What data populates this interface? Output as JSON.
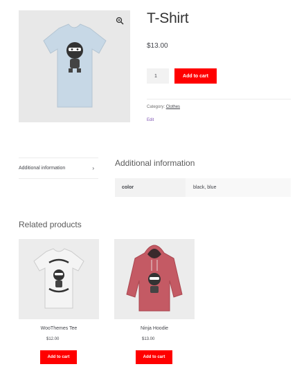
{
  "product": {
    "title": "T-Shirt",
    "price": "$13.00",
    "quantity": "1",
    "add_to_cart_label": "Add to cart",
    "category_label": "Category:",
    "category_link": "Clothes",
    "edit_label": "Edit",
    "image_color": "#c8d8e8"
  },
  "tabs": {
    "items": [
      {
        "label": "Additional information",
        "icon": "chevron-right-icon"
      }
    ],
    "panel_title": "Additional information",
    "attributes": [
      {
        "name": "color",
        "value": "black, blue"
      }
    ]
  },
  "related": {
    "title": "Related products",
    "products": [
      {
        "name": "WooThemes Tee",
        "price": "$12.00",
        "button_label": "Add to cart",
        "image_color": "#f2f2f2"
      },
      {
        "name": "Ninja Hoodie",
        "price": "$13.00",
        "button_label": "Add to cart",
        "image_color": "#c0525e"
      }
    ]
  },
  "colors": {
    "accent": "#ff0000",
    "link": "#7f54b3"
  }
}
